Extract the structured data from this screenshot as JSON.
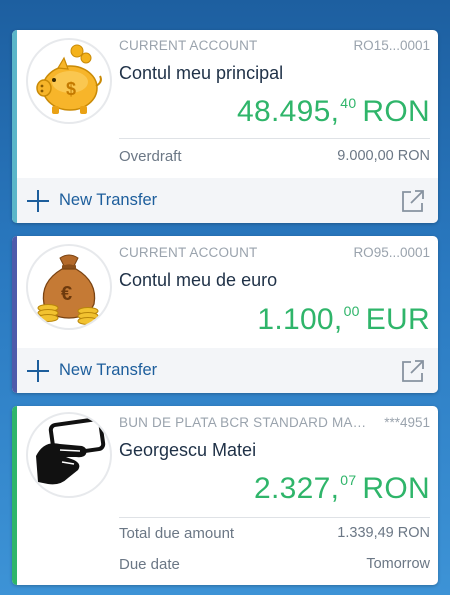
{
  "colors": {
    "accent_blue": "#1d5e9c",
    "balance_green": "#2fb56a",
    "stripe_teal": "#5bb6c9",
    "stripe_indigo": "#4e5bab",
    "stripe_green": "#2fb56a"
  },
  "accounts": [
    {
      "type": "CURRENT ACCOUNT",
      "number": "RO15...0001",
      "name": "Contul meu principal",
      "balance_int": "48.495,",
      "balance_dec": "40",
      "currency": "RON",
      "icon": "piggy-bank-icon",
      "overdraft_label": "Overdraft",
      "overdraft_value": "9.000,00 RON",
      "transfer_label": "New Transfer"
    },
    {
      "type": "CURRENT ACCOUNT",
      "number": "RO95...0001",
      "name": "Contul meu de euro",
      "balance_int": "1.100,",
      "balance_dec": "00",
      "currency": "EUR",
      "icon": "money-bag-icon",
      "transfer_label": "New Transfer"
    },
    {
      "type": "BUN DE PLATA BCR STANDARD MASTERCARD",
      "number": "***4951",
      "name": "Georgescu Matei",
      "balance_int": "2.327,",
      "balance_dec": "07",
      "currency": "RON",
      "icon": "credit-card-hand-icon",
      "due_label": "Total due amount",
      "due_value": "1.339,49 RON",
      "date_label": "Due date",
      "date_value": "Tomorrow"
    }
  ]
}
